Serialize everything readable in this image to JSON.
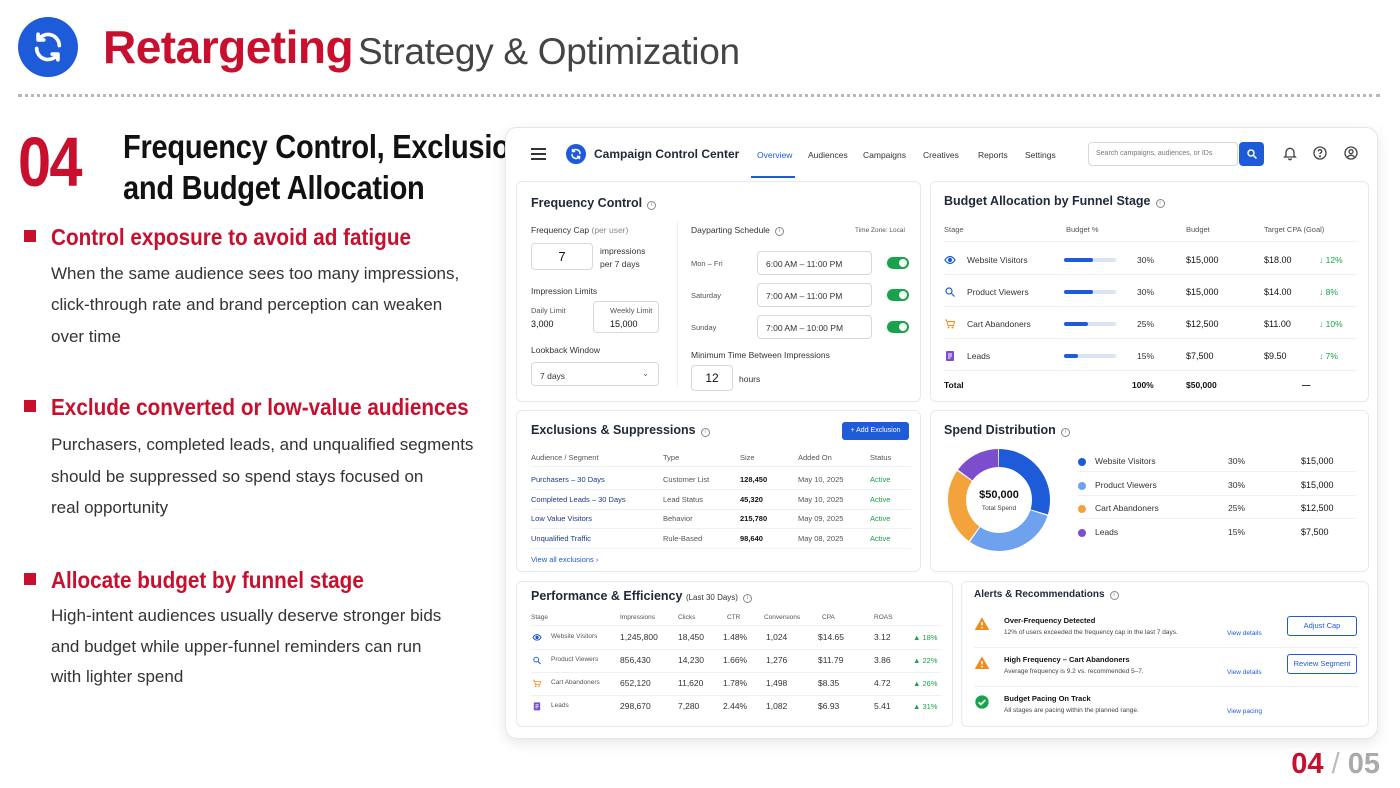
{
  "slide": {
    "brand": "Retargeting",
    "subtitle": "Strategy & Optimization",
    "section_number": "04",
    "heading_line1": "Frequency Control, Exclusions,",
    "heading_line2": "and Budget Allocation",
    "page_current": "04",
    "page_sep": "/",
    "page_total": "05",
    "colors": {
      "accent": "#c8102e",
      "brand_blue": "#1e5bd8"
    },
    "bullets": [
      {
        "heading": "Control exposure to avoid ad fatigue",
        "lines": [
          "When the same audience sees too many impressions,",
          "click-through rate and brand perception can weaken",
          "over time"
        ]
      },
      {
        "heading": "Exclude converted or low-value audiences",
        "lines": [
          "Purchasers, completed leads, and unqualified segments",
          "should be suppressed so spend stays focused on",
          "real opportunity"
        ]
      },
      {
        "heading": "Allocate budget by funnel stage",
        "lines": [
          "High-intent audiences usually deserve stronger bids",
          "and budget while upper-funnel reminders can run",
          "with lighter spend"
        ]
      }
    ]
  },
  "app": {
    "title": "Campaign Control Center",
    "nav": [
      "Overview",
      "Audiences",
      "Campaigns",
      "Creatives",
      "Reports",
      "Settings"
    ],
    "active_nav": "Overview",
    "search_placeholder": "Search campaigns, audiences, or IDs"
  },
  "frequency": {
    "title": "Frequency Control",
    "cap_label": "Frequency Cap",
    "cap_hint": "(per user)",
    "cap_value": "7",
    "cap_unit1": "impressions",
    "cap_unit2": "per 7 days",
    "limits_label": "Impression Limits",
    "daily_label": "Daily Limit",
    "daily_value": "3,000",
    "weekly_label": "Weekly Limit",
    "weekly_value": "15,000",
    "lookback_label": "Lookback Window",
    "lookback_value": "7 days",
    "dayparting_label": "Dayparting Schedule",
    "timezone": "Time Zone: Local",
    "schedule": [
      {
        "day": "Mon – Fri",
        "range": "6:00 AM  –  11:00 PM"
      },
      {
        "day": "Saturday",
        "range": "7:00 AM  –  11:00 PM"
      },
      {
        "day": "Sunday",
        "range": "7:00 AM  –  10:00 PM"
      }
    ],
    "min_time_label": "Minimum Time Between Impressions",
    "min_time_value": "12",
    "min_time_unit": "hours"
  },
  "budget": {
    "title": "Budget Allocation by Funnel Stage",
    "headers": [
      "Stage",
      "Budget %",
      "Budget",
      "Target CPA (Goal)"
    ],
    "rows": [
      {
        "icon": "eye-icon",
        "stage": "Website Visitors",
        "pct_value": 30,
        "pct": "30%",
        "budget": "$15,000",
        "cpa": "$18.00",
        "delta": "↓ 12%"
      },
      {
        "icon": "search-icon",
        "stage": "Product Viewers",
        "pct_value": 30,
        "pct": "30%",
        "budget": "$15,000",
        "cpa": "$14.00",
        "delta": "↓ 8%"
      },
      {
        "icon": "cart-icon",
        "stage": "Cart Abandoners",
        "pct_value": 25,
        "pct": "25%",
        "budget": "$12,500",
        "cpa": "$11.00",
        "delta": "↓ 10%"
      },
      {
        "icon": "document-icon",
        "stage": "Leads",
        "pct_value": 15,
        "pct": "15%",
        "budget": "$7,500",
        "cpa": "$9.50",
        "delta": "↓ 7%"
      }
    ],
    "total_label": "Total",
    "total_pct": "100%",
    "total_budget": "$50,000",
    "total_cpa": "—"
  },
  "exclusions": {
    "title": "Exclusions & Suppressions",
    "add_button": "+ Add Exclusion",
    "headers": [
      "Audience / Segment",
      "Type",
      "Size",
      "Added On",
      "Status"
    ],
    "rows": [
      {
        "name": "Purchasers – 30 Days",
        "type": "Customer List",
        "size": "128,450",
        "added": "May 10, 2025",
        "status": "Active"
      },
      {
        "name": "Completed Leads – 30 Days",
        "type": "Lead Status",
        "size": "45,320",
        "added": "May 10, 2025",
        "status": "Active"
      },
      {
        "name": "Low Value Visitors",
        "type": "Behavior",
        "size": "215,780",
        "added": "May 09, 2025",
        "status": "Active"
      },
      {
        "name": "Unqualified Traffic",
        "type": "Rule-Based",
        "size": "98,640",
        "added": "May 08, 2025",
        "status": "Active"
      }
    ],
    "view_all": "View all exclusions"
  },
  "spend": {
    "title": "Spend Distribution",
    "total": "$50,000",
    "total_label": "Total Spend",
    "items": [
      {
        "label": "Website Visitors",
        "pct_value": 30,
        "pct": "30%",
        "amount": "$15,000",
        "color": "#1e5bd8"
      },
      {
        "label": "Product Viewers",
        "pct_value": 30,
        "pct": "30%",
        "amount": "$15,000",
        "color": "#6fa2ee"
      },
      {
        "label": "Cart Abandoners",
        "pct_value": 25,
        "pct": "25%",
        "amount": "$12,500",
        "color": "#f4a23b"
      },
      {
        "label": "Leads",
        "pct_value": 15,
        "pct": "15%",
        "amount": "$7,500",
        "color": "#7c4dcc"
      }
    ]
  },
  "performance": {
    "title": "Performance & Efficiency",
    "period": "(Last 30 Days)",
    "headers": [
      "Stage",
      "Impressions",
      "Clicks",
      "CTR",
      "Conversions",
      "CPA",
      "ROAS"
    ],
    "rows": [
      {
        "icon": "eye-icon",
        "stage": "Website Visitors",
        "impressions": "1,245,800",
        "clicks": "18,450",
        "ctr": "1.48%",
        "conversions": "1,024",
        "cpa": "$14.65",
        "roas": "3.12",
        "delta": "▲ 18%"
      },
      {
        "icon": "search-icon",
        "stage": "Product Viewers",
        "impressions": "856,430",
        "clicks": "14,230",
        "ctr": "1.66%",
        "conversions": "1,276",
        "cpa": "$11.79",
        "roas": "3.86",
        "delta": "▲ 22%"
      },
      {
        "icon": "cart-icon",
        "stage": "Cart Abandoners",
        "impressions": "652,120",
        "clicks": "11,620",
        "ctr": "1.78%",
        "conversions": "1,498",
        "cpa": "$8.35",
        "roas": "4.72",
        "delta": "▲ 26%"
      },
      {
        "icon": "document-icon",
        "stage": "Leads",
        "impressions": "298,670",
        "clicks": "7,280",
        "ctr": "2.44%",
        "conversions": "1,082",
        "cpa": "$6.93",
        "roas": "5.41",
        "delta": "▲ 31%"
      }
    ]
  },
  "alerts": {
    "title": "Alerts & Recommendations",
    "items": [
      {
        "icon": "warning-icon",
        "title": "Over-Frequency Detected",
        "text": "12% of users exceeded the frequency cap in the last 7 days.",
        "link": "View details",
        "button": "Adjust Cap"
      },
      {
        "icon": "warning-icon",
        "title": "High Frequency – Cart Abandoners",
        "text": "Average frequency is 9.2 vs. recommended 5–7.",
        "link": "View details",
        "button": "Review Segment"
      },
      {
        "icon": "check-circle-icon",
        "title": "Budget Pacing On Track",
        "text": "All stages are pacing within the planned range.",
        "link": "View pacing",
        "button": ""
      }
    ]
  }
}
